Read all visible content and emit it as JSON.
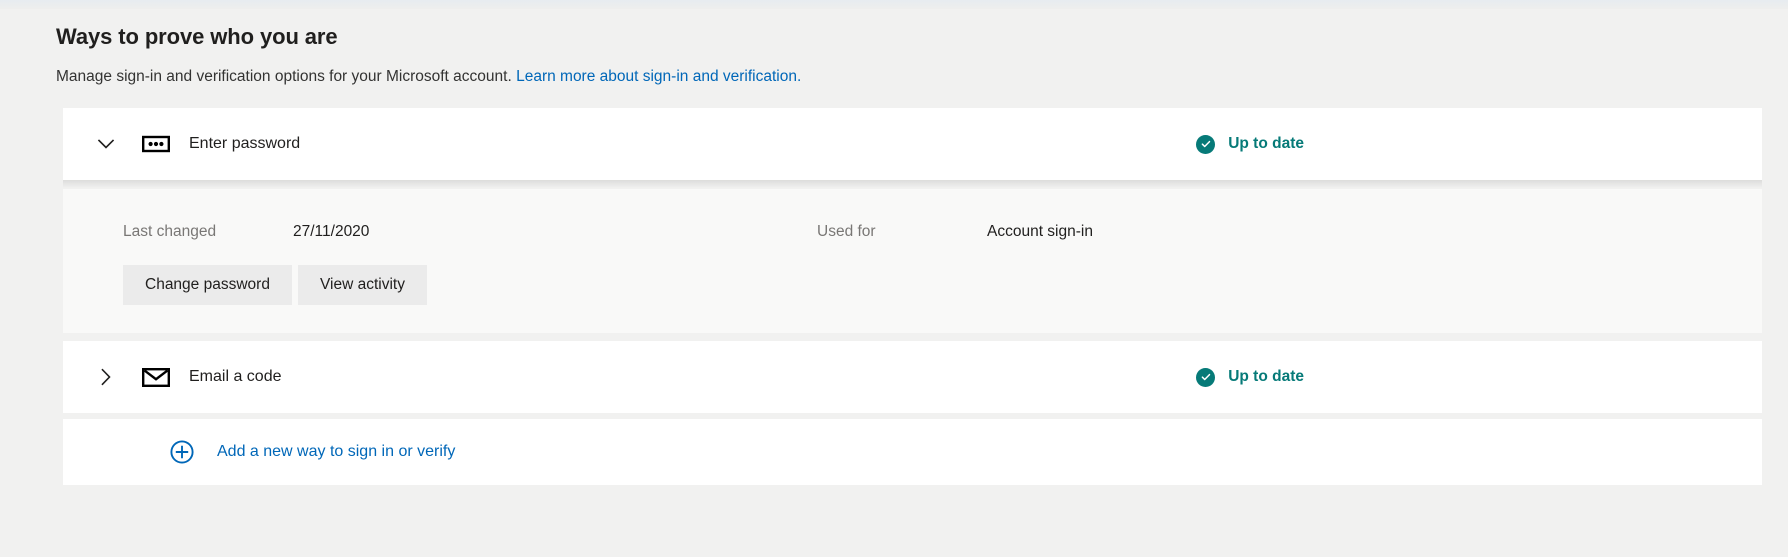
{
  "page": {
    "title": "Ways to prove who you are",
    "subtitle_text": "Manage sign-in and verification options for your Microsoft account.",
    "subtitle_link": "Learn more about sign-in and verification.",
    "accent_link_color": "#0067b8",
    "status_color": "#067a78",
    "background_color": "#f1f1f0"
  },
  "methods": [
    {
      "label": "Enter password",
      "icon": "password-dots-icon",
      "chevron": "chevron-down-icon",
      "expanded": true,
      "status": {
        "label": "Up to date",
        "icon": "check-circle-icon"
      },
      "details": {
        "fields": [
          {
            "label": "Last changed",
            "value": "27/11/2020"
          },
          {
            "label": "Used for",
            "value": "Account sign-in"
          }
        ],
        "actions": [
          {
            "label": "Change password"
          },
          {
            "label": "View activity"
          }
        ]
      }
    },
    {
      "label": "Email a code",
      "icon": "envelope-icon",
      "chevron": "chevron-right-icon",
      "expanded": false,
      "status": {
        "label": "Up to date",
        "icon": "check-circle-icon"
      }
    }
  ],
  "add_method": {
    "label": "Add a new way to sign in or verify",
    "icon": "plus-circle-icon"
  }
}
